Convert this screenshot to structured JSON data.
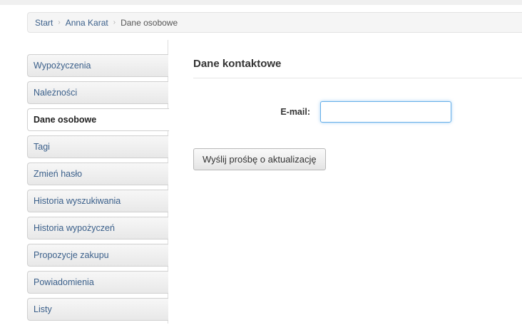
{
  "breadcrumb": {
    "items": [
      "Start",
      "Anna Karat"
    ],
    "current": "Dane osobowe",
    "separator": "›"
  },
  "sidebar": {
    "items": [
      {
        "label": "Wypożyczenia",
        "active": false
      },
      {
        "label": "Należności",
        "active": false
      },
      {
        "label": "Dane osobowe",
        "active": true
      },
      {
        "label": "Tagi",
        "active": false
      },
      {
        "label": "Zmień hasło",
        "active": false
      },
      {
        "label": "Historia wyszukiwania",
        "active": false
      },
      {
        "label": "Historia wypożyczeń",
        "active": false
      },
      {
        "label": "Propozycje zakupu",
        "active": false
      },
      {
        "label": "Powiadomienia",
        "active": false
      },
      {
        "label": "Listy",
        "active": false
      }
    ]
  },
  "main": {
    "section_title": "Dane kontaktowe",
    "email_label": "E-mail:",
    "email_value": "",
    "submit_label": "Wyślij prośbę o aktualizację"
  },
  "colors": {
    "link": "#3a5f8a",
    "focus_border": "#66afe9"
  }
}
